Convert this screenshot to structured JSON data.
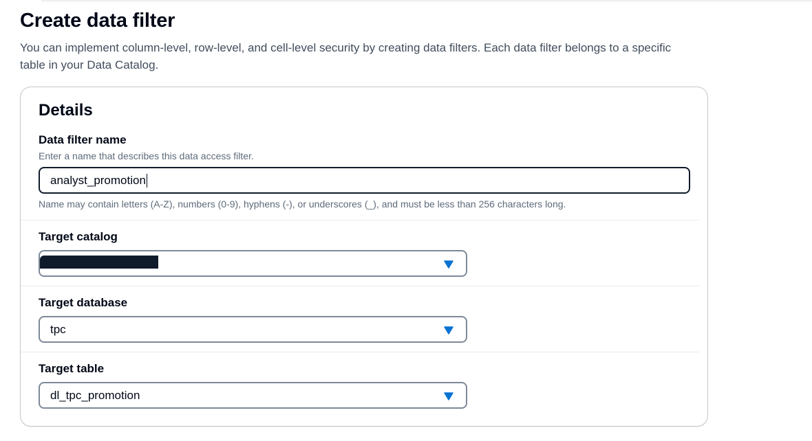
{
  "page": {
    "title": "Create data filter",
    "description": "You can implement column-level, row-level, and cell-level security by creating data filters. Each data filter belongs to a specific table in your Data Catalog."
  },
  "details": {
    "title": "Details",
    "filter_name": {
      "label": "Data filter name",
      "description": "Enter a name that describes this data access filter.",
      "value": "analyst_promotion",
      "constraint": "Name may contain letters (A-Z), numbers (0-9), hyphens (-), or underscores (_), and must be less than 256 characters long."
    },
    "target_catalog": {
      "label": "Target catalog",
      "value": ""
    },
    "target_database": {
      "label": "Target database",
      "value": "tpc"
    },
    "target_table": {
      "label": "Target table",
      "value": "dl_tpc_promotion"
    }
  },
  "colors": {
    "accent": "#0972d3",
    "text": "#000716",
    "secondary_text": "#5f6b7a",
    "border": "#c6c6cd"
  },
  "icons": {
    "dropdown": "caret-down-filled-icon"
  }
}
